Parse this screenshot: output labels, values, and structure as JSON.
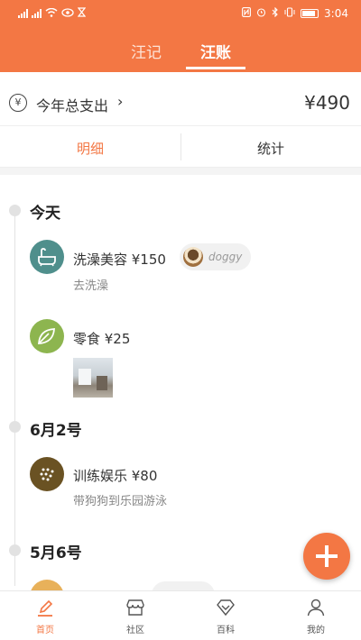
{
  "statusbar": {
    "time": "3:04",
    "battery_icon": "battery-icon"
  },
  "tabs": [
    {
      "label": "汪记"
    },
    {
      "label": "汪账"
    }
  ],
  "summary": {
    "label": "今年总支出",
    "total": "¥490",
    "currency_icon": "yen-icon"
  },
  "subtabs": [
    {
      "label": "明细"
    },
    {
      "label": "统计"
    }
  ],
  "days": [
    {
      "title": "今天",
      "entries": [
        {
          "title": "洗澡美容 ¥150",
          "note": "去洗澡",
          "pet": "doggy",
          "icon": "bathtub-icon",
          "icon_color": "#4f8f8c"
        },
        {
          "title": "零食 ¥25",
          "icon": "leaf-icon",
          "icon_color": "#8db54f",
          "has_photo": true
        }
      ]
    },
    {
      "title": "6月2号",
      "entries": [
        {
          "title": "训练娱乐 ¥80",
          "note": "带狗狗到乐园游泳",
          "icon": "dots-icon",
          "icon_color": "#6a5223"
        }
      ]
    },
    {
      "title": "5月6号"
    }
  ],
  "bottom_nav": [
    {
      "label": "首页",
      "icon": "edit-icon"
    },
    {
      "label": "社区",
      "icon": "store-icon"
    },
    {
      "label": "百科",
      "icon": "diamond-icon"
    },
    {
      "label": "我的",
      "icon": "person-icon"
    }
  ],
  "colors": {
    "accent": "#f37744",
    "text": "#333333",
    "muted": "#888888"
  }
}
